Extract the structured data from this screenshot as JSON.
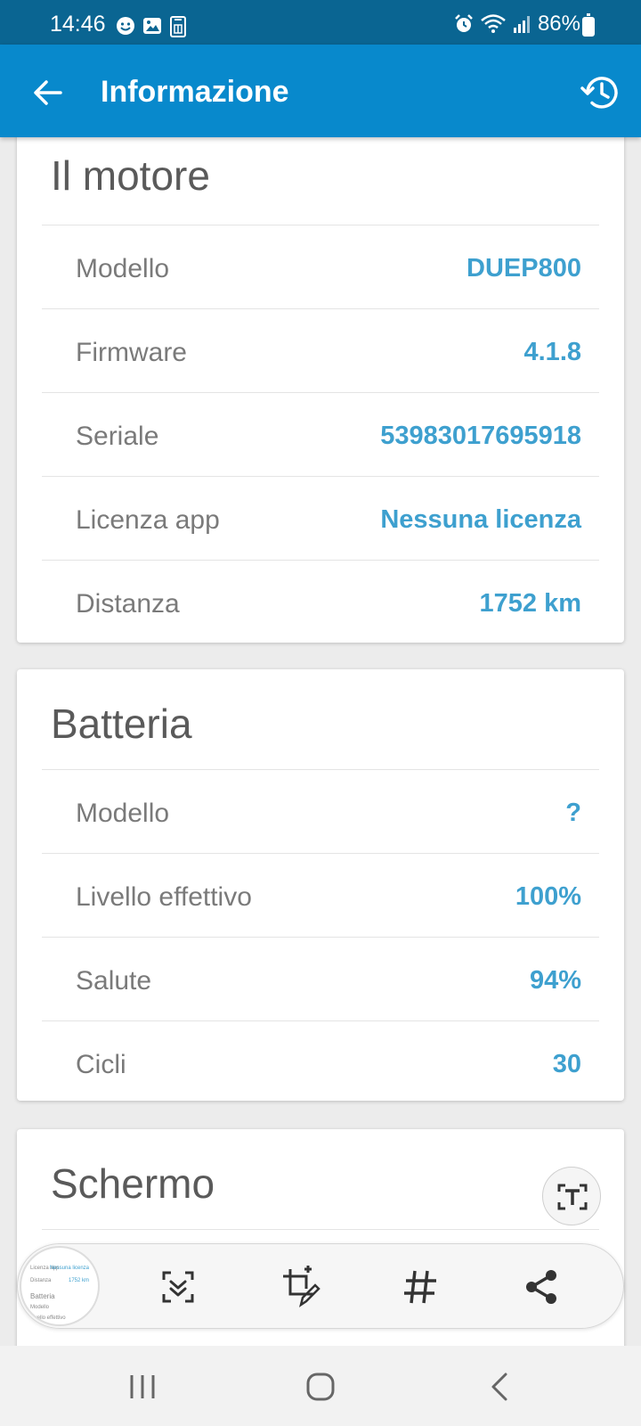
{
  "status_bar": {
    "time": "14:46",
    "battery": "86%",
    "icons_left": [
      "face-icon",
      "image-icon",
      "sim-icon"
    ],
    "icons_right": [
      "alarm-icon",
      "wifi-icon",
      "signal-icon",
      "battery-icon"
    ]
  },
  "app_bar": {
    "title": "Informazione",
    "back_icon": "arrow-back-icon",
    "history_icon": "history-icon"
  },
  "motor": {
    "title": "Il motore",
    "rows": [
      {
        "label": "Modello",
        "value": "DUEP800"
      },
      {
        "label": "Firmware",
        "value": "4.1.8"
      },
      {
        "label": "Seriale",
        "value": "53983017695918"
      },
      {
        "label": "Licenza app",
        "value": "Nessuna licenza"
      },
      {
        "label": "Distanza",
        "value": "1752 km"
      }
    ]
  },
  "battery": {
    "title": "Batteria",
    "rows": [
      {
        "label": "Modello",
        "value": "?"
      },
      {
        "label": "Livello effettivo",
        "value": "100%"
      },
      {
        "label": "Salute",
        "value": "94%"
      },
      {
        "label": "Cicli",
        "value": "30"
      }
    ]
  },
  "screen": {
    "title": "Schermo"
  },
  "screenshot_toolbar": {
    "buttons": [
      "scroll-capture-icon",
      "crop-edit-icon",
      "hashtag-icon",
      "share-icon"
    ],
    "ocr_button": "text-extract-icon"
  },
  "nav_bar": {
    "buttons": [
      "recent-apps-icon",
      "home-icon",
      "back-icon"
    ]
  },
  "colors": {
    "status_bar": "#0a6592",
    "app_bar": "#0889cc",
    "value_text": "#3ea0cf",
    "label_text": "#7a7a7a"
  }
}
